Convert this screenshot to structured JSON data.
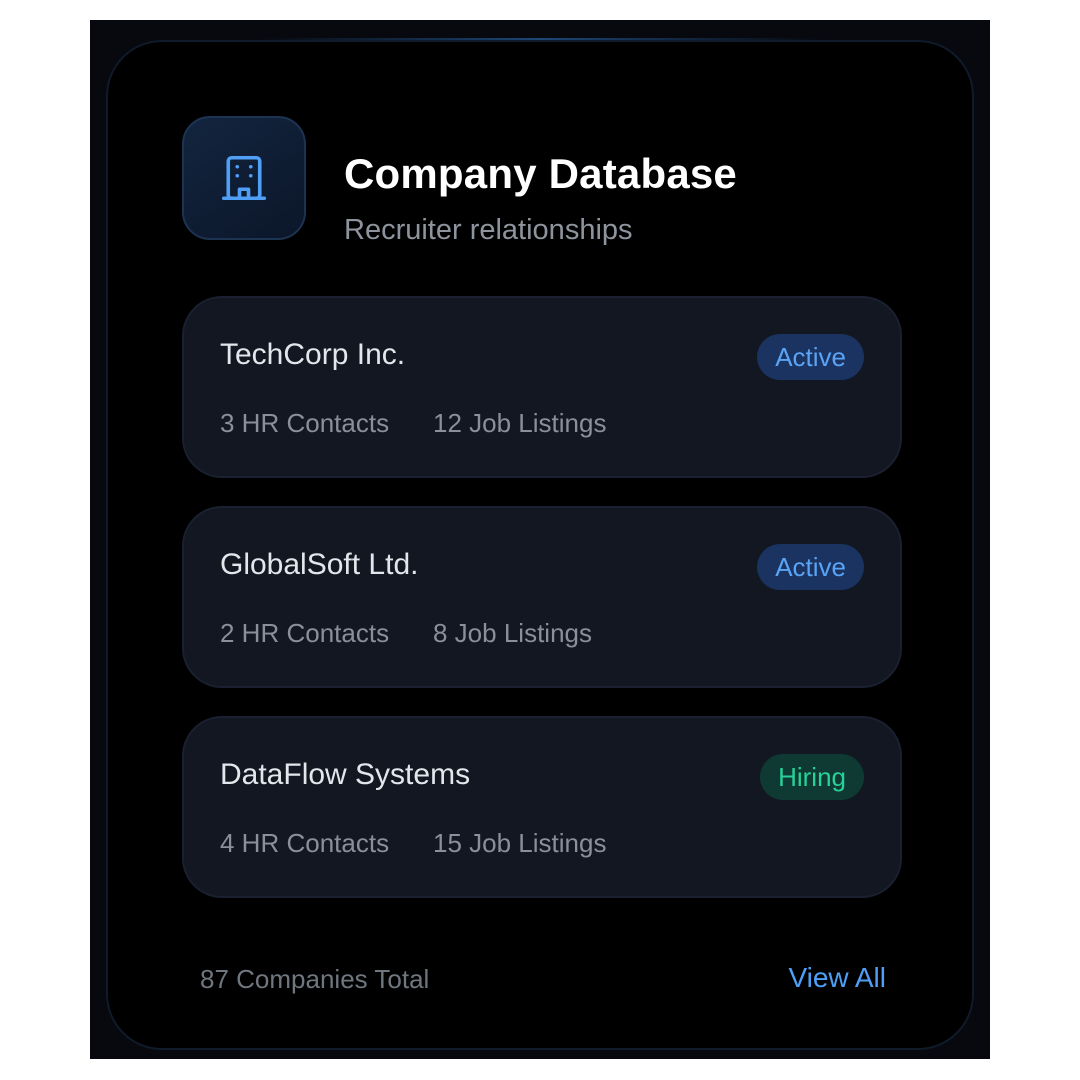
{
  "header": {
    "icon": "building-icon",
    "title": "Company Database",
    "subtitle": "Recruiter relationships"
  },
  "companies": [
    {
      "name": "TechCorp Inc.",
      "status": "Active",
      "hr_contacts": "3 HR Contacts",
      "job_listings": "12 Job Listings"
    },
    {
      "name": "GlobalSoft Ltd.",
      "status": "Active",
      "hr_contacts": "2 HR Contacts",
      "job_listings": "8 Job Listings"
    },
    {
      "name": "DataFlow Systems",
      "status": "Hiring",
      "hr_contacts": "4 HR Contacts",
      "job_listings": "15 Job Listings"
    }
  ],
  "footer": {
    "total": "87 Companies Total",
    "view_all": "View All"
  },
  "colors": {
    "accent": "#4e9ff5",
    "active_badge_bg": "#1a3360",
    "active_badge_text": "#5aa3f5",
    "hiring_badge_bg": "#0f3a33",
    "hiring_badge_text": "#27d197",
    "card_bg": "#121722",
    "background": "#000000"
  }
}
